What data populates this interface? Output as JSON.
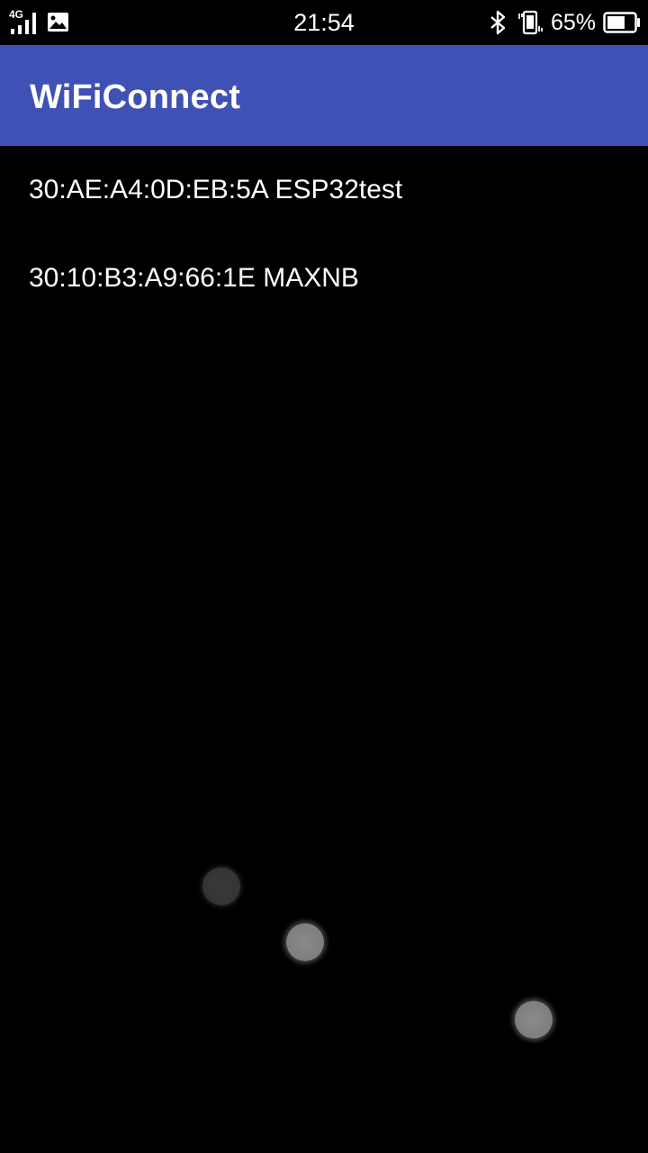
{
  "status_bar": {
    "network_type": "4G",
    "time": "21:54",
    "battery_percent": "65%",
    "battery_level": 0.65,
    "icons": [
      "signal-icon",
      "gallery-icon",
      "bluetooth-icon",
      "vibrate-icon",
      "battery-icon"
    ]
  },
  "app_bar": {
    "title": "WiFiConnect",
    "color": "#3f51b5"
  },
  "devices": [
    {
      "label": "30:AE:A4:0D:EB:5A ESP32test"
    },
    {
      "label": "30:10:B3:A9:66:1E MAXNB"
    }
  ]
}
